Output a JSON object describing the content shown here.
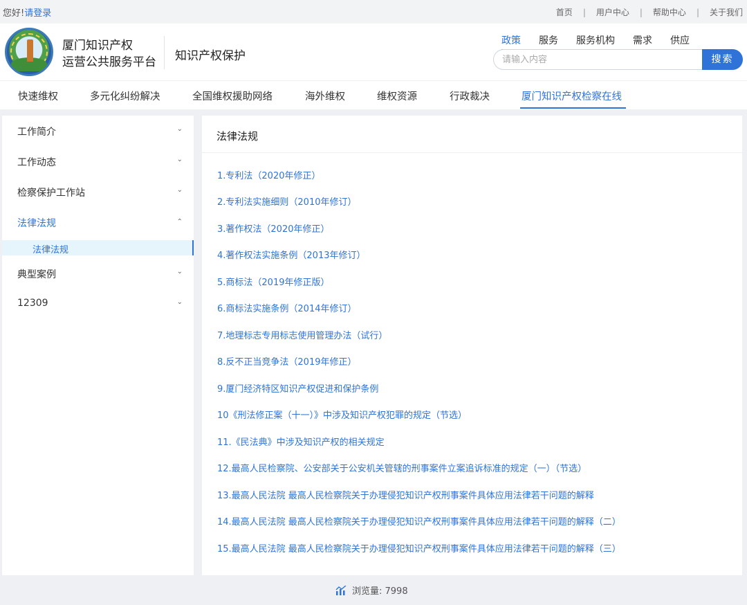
{
  "topbar": {
    "greeting": "您好!",
    "login": "请登录",
    "links": [
      "首页",
      "用户中心",
      "帮助中心",
      "关于我们"
    ]
  },
  "header": {
    "brand_line1": "厦门知识产权",
    "brand_line2": "运营公共服务平台",
    "subtitle": "知识产权保护",
    "tabs": [
      "政策",
      "服务",
      "服务机构",
      "需求",
      "供应"
    ],
    "search_placeholder": "请输入内容",
    "search_button": "搜索"
  },
  "main_nav": [
    "快速维权",
    "多元化纠纷解决",
    "全国维权援助网络",
    "海外维权",
    "维权资源",
    "行政裁决",
    "厦门知识产权检察在线"
  ],
  "sidebar": {
    "items": [
      "工作简介",
      "工作动态",
      "检察保护工作站",
      "法律法规",
      "典型案例",
      "12309"
    ],
    "sub_item": "法律法规"
  },
  "content": {
    "title": "法律法规",
    "laws": [
      "1.专利法（2020年修正）",
      "2.专利法实施细则（2010年修订）",
      "3.著作权法（2020年修正）",
      "4.著作权法实施条例（2013年修订）",
      "5.商标法（2019年修正版）",
      "6.商标法实施条例（2014年修订）",
      "7.地理标志专用标志使用管理办法（试行）",
      "8.反不正当竞争法（2019年修正）",
      "9.厦门经济特区知识产权促进和保护条例",
      "10《刑法修正案（十一）》中涉及知识产权犯罪的规定（节选）",
      "11.《民法典》中涉及知识产权的相关规定",
      "12.最高人民检察院、公安部关于公安机关管辖的刑事案件立案追诉标准的规定（一）（节选）",
      "13.最高人民法院  最高人民检察院关于办理侵犯知识产权刑事案件具体应用法律若干问题的解释",
      "14.最高人民法院  最高人民检察院关于办理侵犯知识产权刑事案件具体应用法律若干问题的解释（二）",
      "15.最高人民法院  最高人民检察院关于办理侵犯知识产权刑事案件具体应用法律若干问题的解释（三）"
    ]
  },
  "footer": {
    "views_label": "浏览量: 7998"
  },
  "colors": {
    "accent": "#2f73d8",
    "page_bg": "#eef0f3"
  }
}
